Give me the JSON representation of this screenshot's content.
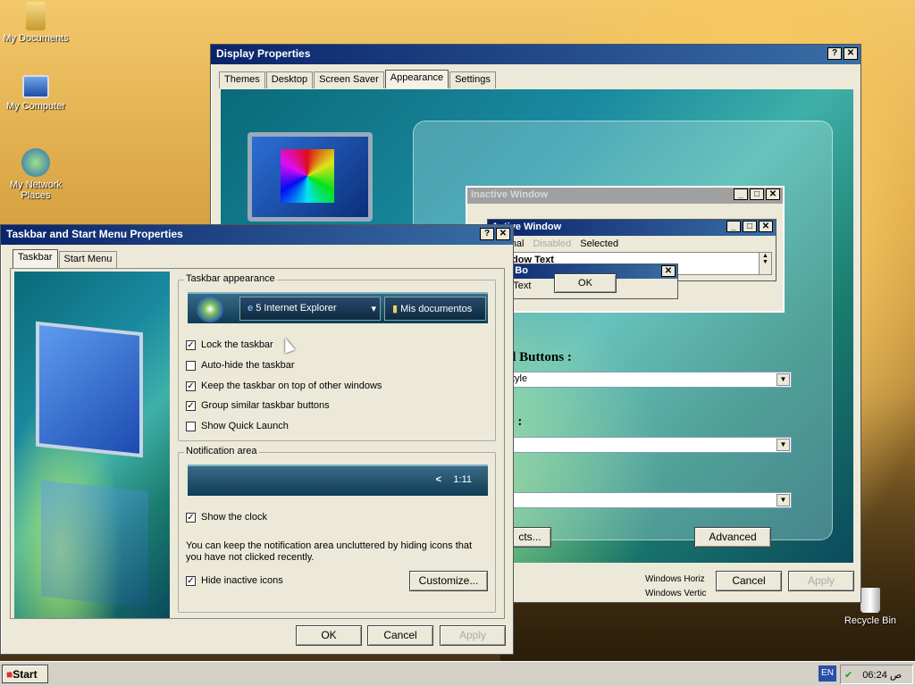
{
  "desktop": {
    "icons": [
      {
        "label": "My Documents",
        "icon": "folder-icon"
      },
      {
        "label": "My Computer",
        "icon": "computer-icon"
      },
      {
        "label": "My Network Places",
        "icon": "network-icon"
      },
      {
        "label": "Recycle Bin",
        "icon": "recycle-bin-icon"
      }
    ]
  },
  "display_props": {
    "title": "Display Properties",
    "tabs": [
      "Themes",
      "Desktop",
      "Screen Saver",
      "Appearance",
      "Settings"
    ],
    "active_tab": "Appearance",
    "preview": {
      "inactive_title": "Inactive Window",
      "active_title": "Active Window",
      "menu": [
        "Normal",
        "Disabled",
        "Selected"
      ],
      "window_text": "Window Text",
      "message_box_title": "ssage Bo",
      "message_text": "ssage Text",
      "ok": "OK"
    },
    "buttons_label": "d Buttons :",
    "buttons_value": "tyle",
    "scheme_label": "e :",
    "scheme_value": "",
    "size_value": "",
    "effects_label": "cts...",
    "advanced_label": "Advanced",
    "cancel_label": "Cancel",
    "apply_label": "Apply",
    "footer_1": "Windows Horiz",
    "footer_2": "Windows Vertic"
  },
  "taskbar_props": {
    "title": "Taskbar and Start Menu Properties",
    "tabs": [
      "Taskbar",
      "Start Menu"
    ],
    "active_tab": "Taskbar",
    "appearance_group": "Taskbar appearance",
    "preview_ie": "5 Internet Explorer",
    "preview_docs": "Mis documentos",
    "options": [
      {
        "label": "Lock the taskbar",
        "checked": true
      },
      {
        "label": "Auto-hide the taskbar",
        "checked": false
      },
      {
        "label": "Keep the taskbar on top of other windows",
        "checked": true
      },
      {
        "label": "Group similar taskbar buttons",
        "checked": true
      },
      {
        "label": "Show Quick Launch",
        "checked": false
      }
    ],
    "notification_group": "Notification area",
    "notif_time": "1:11",
    "show_clock": {
      "label": "Show the clock",
      "checked": true
    },
    "notif_text": "You can keep the notification area uncluttered by hiding icons that you have not clicked recently.",
    "hide_inactive": {
      "label": "Hide inactive icons",
      "checked": true
    },
    "customize_label": "Customize...",
    "ok_label": "OK",
    "cancel_label": "Cancel",
    "apply_label": "Apply"
  },
  "taskbar": {
    "start_label": "Start",
    "lang": "EN",
    "clock": "06:24 ص"
  }
}
